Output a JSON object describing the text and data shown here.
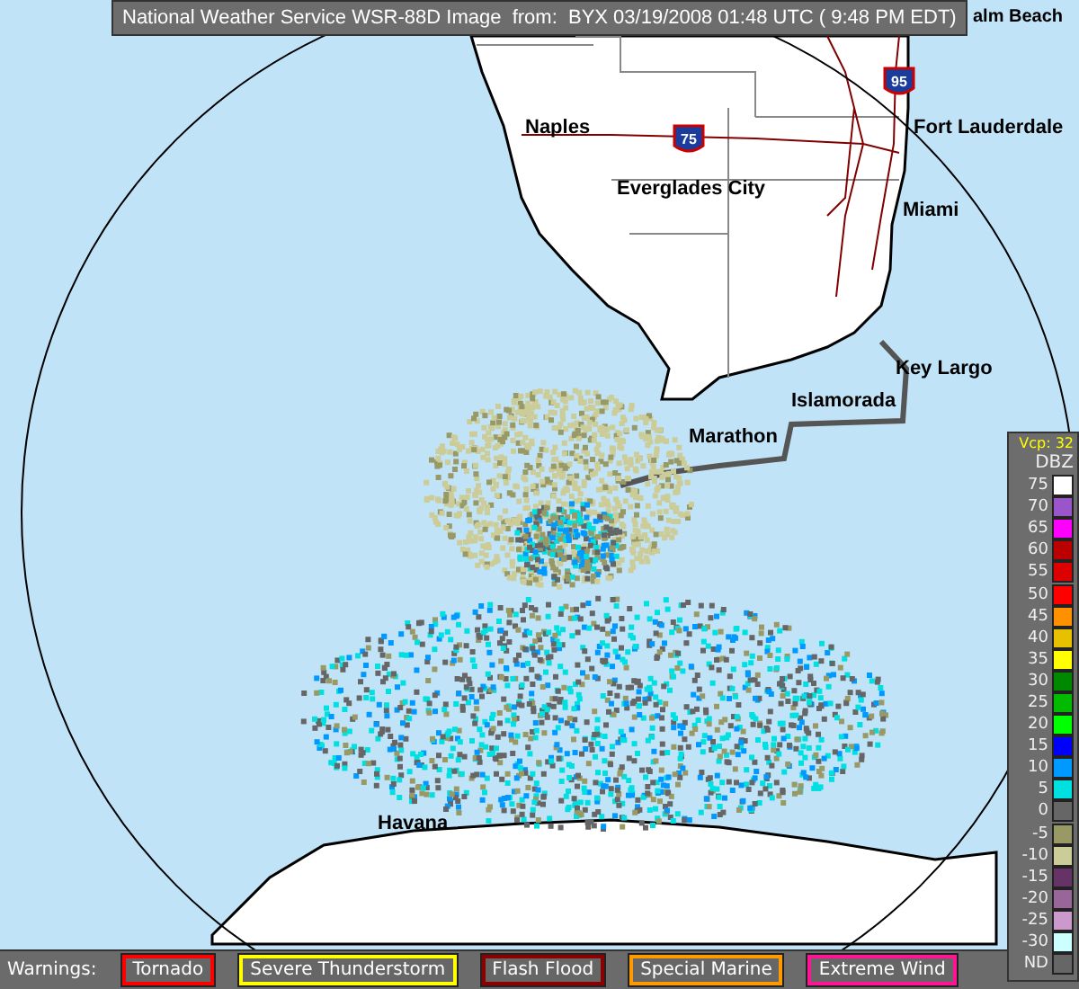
{
  "title": "National Weather Service WSR-88D Image  from:  BYX 03/19/2008 01:48 UTC ( 9:48 PM EDT)",
  "map": {
    "cities": [
      {
        "name": "alm Beach"
      },
      {
        "name": "Naples"
      },
      {
        "name": "Fort Lauderdale"
      },
      {
        "name": "Everglades City"
      },
      {
        "name": "Miami"
      },
      {
        "name": "Key Largo"
      },
      {
        "name": "Islamorada"
      },
      {
        "name": "Marathon"
      },
      {
        "name": "Havana"
      }
    ],
    "highways": [
      {
        "label": "75"
      },
      {
        "label": "95"
      }
    ]
  },
  "legend": {
    "vcp": "Vcp: 32",
    "unit": "DBZ",
    "entries": [
      {
        "label": "75",
        "color": "#ffffff"
      },
      {
        "label": "70",
        "color": "#9955c9"
      },
      {
        "label": "65",
        "color": "#ff00ff"
      },
      {
        "label": "60",
        "color": "#bb0000"
      },
      {
        "label": "55",
        "color": "#dd0000"
      },
      {
        "label": "50",
        "color": "#ff0000"
      },
      {
        "label": "45",
        "color": "#ff9000"
      },
      {
        "label": "40",
        "color": "#e7c000"
      },
      {
        "label": "35",
        "color": "#ffff00"
      },
      {
        "label": "30",
        "color": "#008800"
      },
      {
        "label": "25",
        "color": "#00bb00"
      },
      {
        "label": "20",
        "color": "#00ff00"
      },
      {
        "label": "15",
        "color": "#0000ff"
      },
      {
        "label": "10",
        "color": "#0099ff"
      },
      {
        "label": "5",
        "color": "#00e0e0"
      },
      {
        "label": "0",
        "color": "#666666"
      },
      {
        "label": "-5",
        "color": "#999966"
      },
      {
        "label": "-10",
        "color": "#cccc99"
      },
      {
        "label": "-15",
        "color": "#663366"
      },
      {
        "label": "-20",
        "color": "#996699"
      },
      {
        "label": "-25",
        "color": "#cc99cc"
      },
      {
        "label": "-30",
        "color": "#ccffff"
      },
      {
        "label": "ND",
        "color": "#666666"
      }
    ]
  },
  "warnings": {
    "label": "Warnings:",
    "items": [
      {
        "label": "Tornado",
        "color": "#ff0000"
      },
      {
        "label": "Severe Thunderstorm",
        "color": "#ffff00"
      },
      {
        "label": "Flash Flood",
        "color": "#8b0000"
      },
      {
        "label": "Special Marine",
        "color": "#ff9900"
      },
      {
        "label": "Extreme Wind",
        "color": "#ff1493"
      }
    ]
  }
}
